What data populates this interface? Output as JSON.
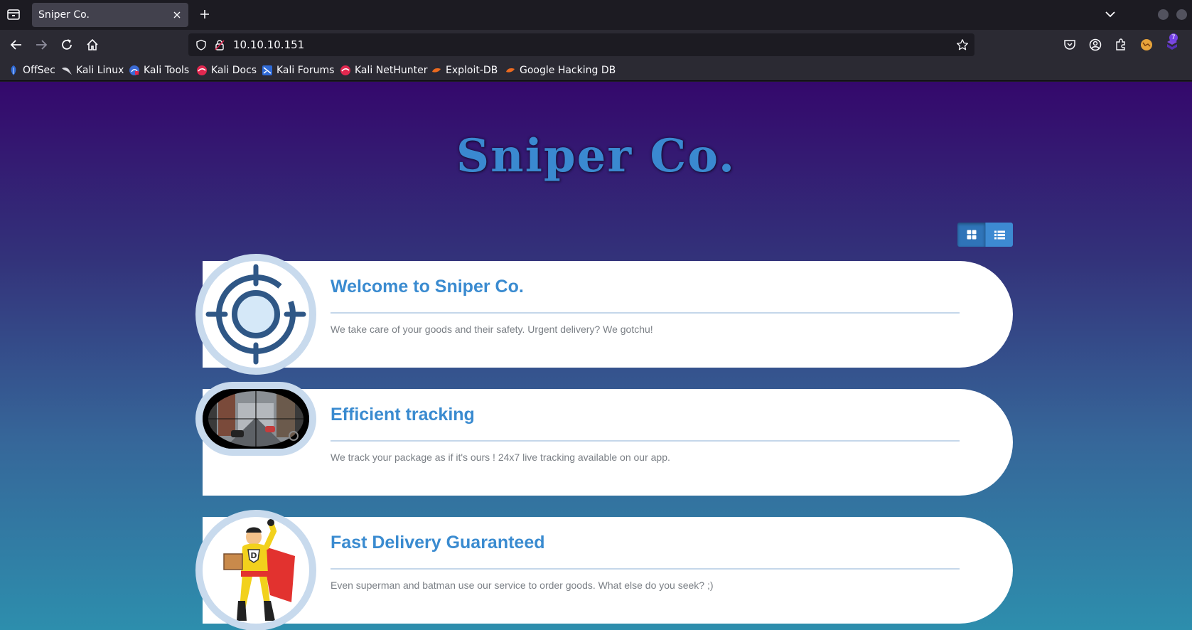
{
  "browser": {
    "tab_title": "Sniper Co.",
    "url": "10.10.10.151",
    "extensions_badge": "7",
    "bookmarks": [
      {
        "label": "OffSec",
        "icon": "offsec-icon"
      },
      {
        "label": "Kali Linux",
        "icon": "kali-dragon-icon"
      },
      {
        "label": "Kali Tools",
        "icon": "kali-tools-icon"
      },
      {
        "label": "Kali Docs",
        "icon": "kali-docs-icon"
      },
      {
        "label": "Kali Forums",
        "icon": "kali-forums-icon"
      },
      {
        "label": "Kali NetHunter",
        "icon": "kali-nethunter-icon"
      },
      {
        "label": "Exploit-DB",
        "icon": "exploit-db-icon"
      },
      {
        "label": "Google Hacking DB",
        "icon": "ghdb-icon"
      }
    ]
  },
  "page": {
    "title": "Sniper Co.",
    "view_toggle": {
      "active": "grid",
      "options": [
        "grid",
        "list"
      ]
    },
    "cards": [
      {
        "heading": "Welcome to Sniper Co.",
        "text": "We take care of your goods and their safety. Urgent delivery? We gotchu!",
        "image": "crosshair-icon"
      },
      {
        "heading": "Efficient tracking",
        "text": "We track your package as if it's ours ! 24x7 live tracking available on our app.",
        "image": "scope-view-image"
      },
      {
        "heading": "Fast Delivery Guaranteed",
        "text": "Even superman and batman use our service to order goods. What else do you seek? ;)",
        "image": "superhero-courier-image"
      }
    ]
  },
  "colors": {
    "accent": "#3a8bd0",
    "toggle_active": "#2f74b8",
    "card_border": "#c8daed"
  }
}
